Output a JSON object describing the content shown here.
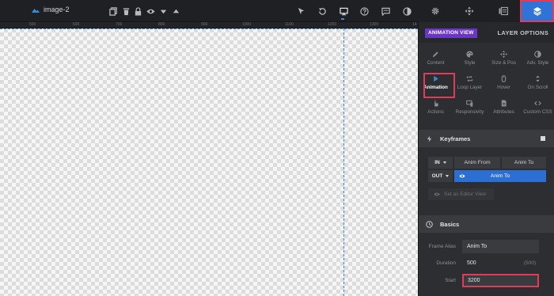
{
  "toolbar": {
    "layer_title": "image-2",
    "icons": [
      "copy-icon",
      "trash-icon",
      "lock-icon",
      "eye-icon",
      "caret-down-icon",
      "caret-up-icon",
      "cursor-icon",
      "undo-icon",
      "desktop-icon",
      "help-icon",
      "chat-icon",
      "contrast-icon"
    ]
  },
  "ruler": {
    "ticks": [
      "500",
      "600",
      "700",
      "800",
      "900",
      "1000",
      "1100",
      "1200",
      "1300",
      "14"
    ]
  },
  "panel_tabs": [
    "gear-icon",
    "move-icon",
    "slides-icon",
    "layers-icon"
  ],
  "panel": {
    "view_badge": "ANIMATION VIEW",
    "layer_options": "LAYER OPTIONS",
    "tools": [
      {
        "label": "Content",
        "icon": "pencil-icon"
      },
      {
        "label": "Style",
        "icon": "palette-icon"
      },
      {
        "label": "Size & Pos",
        "icon": "move-icon"
      },
      {
        "label": "Adv. Style",
        "icon": "contrast-icon"
      },
      {
        "label": "Animation",
        "icon": "play-icon"
      },
      {
        "label": "Loop Layer",
        "icon": "loop-icon"
      },
      {
        "label": "Hover",
        "icon": "mouse-icon"
      },
      {
        "label": "On Scroll",
        "icon": "scroll-icon"
      },
      {
        "label": "Actions",
        "icon": "hand-icon"
      },
      {
        "label": "Responsivity",
        "icon": "devices-icon"
      },
      {
        "label": "Attributes",
        "icon": "file-icon"
      },
      {
        "label": "Custom CSS",
        "icon": "code-icon"
      }
    ],
    "keyframes": {
      "title": "Keyframes",
      "in_label": "IN",
      "out_label": "OUT",
      "anim_from": "Anim From",
      "anim_to": "Anim To",
      "anim_to_active": "Anim To",
      "editor_view": "Set as Editor View"
    },
    "basics": {
      "title": "Basics",
      "frame_alias_label": "Frame Alias",
      "frame_alias_value": "Anim To",
      "duration_label": "Duration",
      "duration_value": "500",
      "duration_default": "(500)",
      "start_label": "Start",
      "start_value": "3200"
    }
  },
  "colors": {
    "accent": "#2f73d6",
    "highlight": "#e43a5a",
    "badge": "#6b35c7"
  }
}
